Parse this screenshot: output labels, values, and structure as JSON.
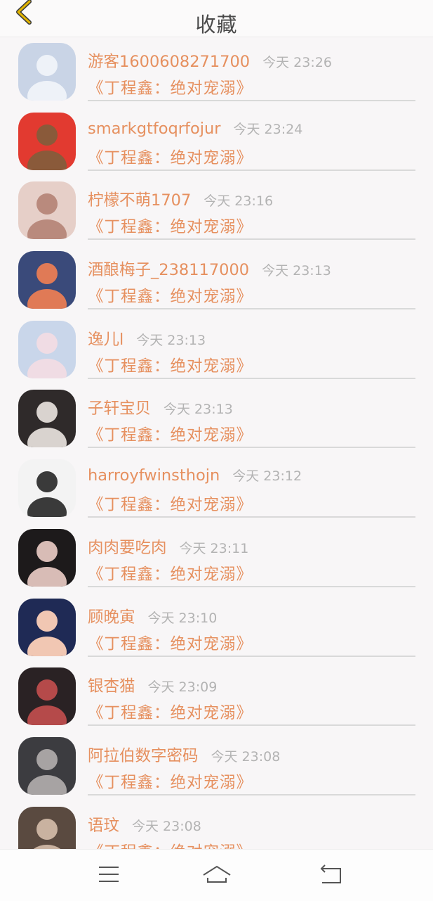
{
  "header": {
    "title": "收藏"
  },
  "items": [
    {
      "name": "游客1600608271700",
      "time": "今天 23:26",
      "message": "《丁程鑫：绝对宠溺》",
      "avatar_bg": "#c9d4e6",
      "avatar_fg": "#eef2f8"
    },
    {
      "name": "smarkgtfoqrfojur",
      "time": "今天 23:24",
      "message": "《丁程鑫：绝对宠溺》",
      "avatar_bg": "#e23a30",
      "avatar_fg": "#8a5a3a"
    },
    {
      "name": "柠檬不萌1707",
      "time": "今天 23:16",
      "message": "《丁程鑫：绝对宠溺》",
      "avatar_bg": "#e6cfc8",
      "avatar_fg": "#b98a7d"
    },
    {
      "name": "酒酿梅子_238117000",
      "time": "今天 23:13",
      "message": "《丁程鑫：绝对宠溺》",
      "avatar_bg": "#3a4a7a",
      "avatar_fg": "#e07a56"
    },
    {
      "name": "逸儿l",
      "time": "今天 23:13",
      "message": "《丁程鑫：绝对宠溺》",
      "avatar_bg": "#c9d6ea",
      "avatar_fg": "#f0dce4"
    },
    {
      "name": "子轩宝贝",
      "time": "今天 23:13",
      "message": "《丁程鑫：绝对宠溺》",
      "avatar_bg": "#2f2a2a",
      "avatar_fg": "#d9d3cf"
    },
    {
      "name": "harroyfwinsthojn",
      "time": "今天 23:12",
      "message": "《丁程鑫：绝对宠溺》",
      "avatar_bg": "#f3f3f3",
      "avatar_fg": "#3a3a3a"
    },
    {
      "name": "肉肉要吃肉",
      "time": "今天 23:11",
      "message": "《丁程鑫：绝对宠溺》",
      "avatar_bg": "#1d1a1b",
      "avatar_fg": "#d8bcb6"
    },
    {
      "name": "顾晚寅",
      "time": "今天 23:10",
      "message": "《丁程鑫：绝对宠溺》",
      "avatar_bg": "#1f2a55",
      "avatar_fg": "#f1c7b3"
    },
    {
      "name": "银杏猫",
      "time": "今天 23:09",
      "message": "《丁程鑫：绝对宠溺》",
      "avatar_bg": "#2a2224",
      "avatar_fg": "#b54a4a"
    },
    {
      "name": "阿拉伯数字密码",
      "time": "今天 23:08",
      "message": "《丁程鑫：绝对宠溺》",
      "avatar_bg": "#3c3c40",
      "avatar_fg": "#a7a3a3"
    },
    {
      "name": "语玟",
      "time": "今天 23:08",
      "message": "《丁程鑫：绝对宠溺》",
      "avatar_bg": "#5a4a40",
      "avatar_fg": "#c9b2a0"
    }
  ],
  "icons": {
    "back": "chevron-left-icon",
    "menu": "menu-icon",
    "home": "home-icon",
    "return": "return-icon"
  },
  "colors": {
    "accent": "#e6905f",
    "back_icon": "#e1b400",
    "time": "#b3b3b3"
  }
}
